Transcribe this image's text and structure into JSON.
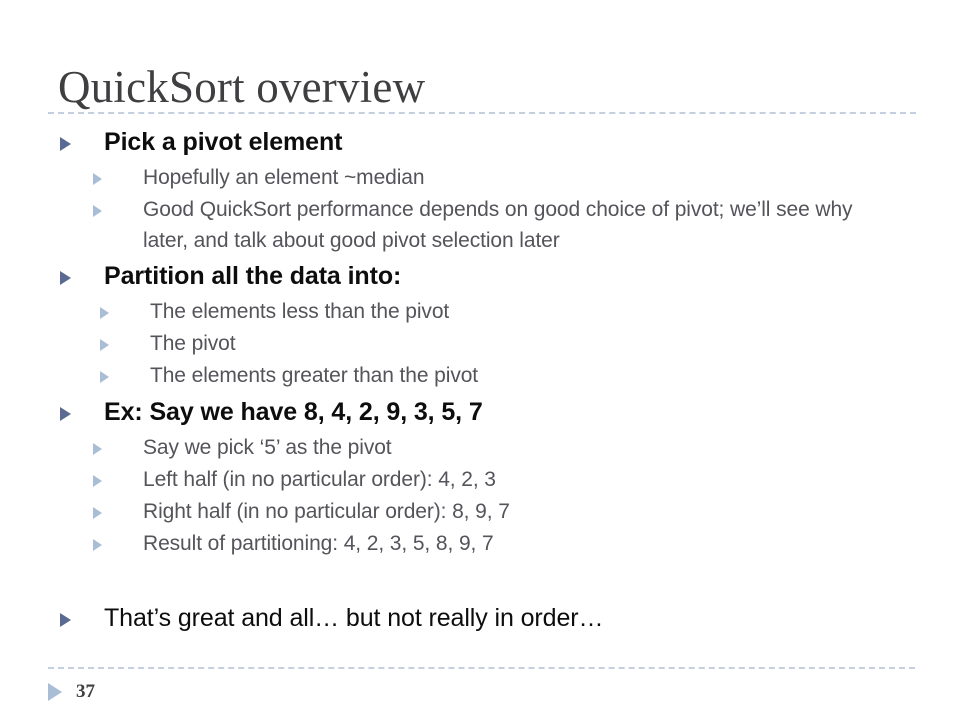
{
  "slide": {
    "title": "QuickSort overview",
    "page_number": "37",
    "accent_color_level1": "#5b6a93",
    "accent_color_level2": "#a9bdd4",
    "title_color": "#3f3f42",
    "rule_color": "#c4cfe0",
    "body_text_color": "#54545a",
    "heading_text_color": "#0d0d0d"
  },
  "bullets": [
    {
      "level": 1,
      "bold": true,
      "text": "Pick a pivot element"
    },
    {
      "level": 2,
      "indent": "a",
      "text": "Hopefully an element ~median"
    },
    {
      "level": 2,
      "indent": "a",
      "text": "Good QuickSort performance depends on good choice of pivot; we’ll see why later, and talk about good pivot selection later"
    },
    {
      "level": 1,
      "bold": true,
      "text": "Partition all the data into:"
    },
    {
      "level": 2,
      "indent": "b",
      "text": "The elements less than the pivot"
    },
    {
      "level": 2,
      "indent": "b",
      "text": "The pivot"
    },
    {
      "level": 2,
      "indent": "b",
      "text": "The elements greater than the pivot"
    },
    {
      "level": 1,
      "bold": true,
      "text": "Ex:  Say we have 8, 4, 2, 9, 3, 5, 7"
    },
    {
      "level": 2,
      "indent": "a",
      "text": "Say we pick ‘5’ as the pivot"
    },
    {
      "level": 2,
      "indent": "a",
      "text": "Left half (in no particular order): 4, 2, 3"
    },
    {
      "level": 2,
      "indent": "a",
      "text": "Right half (in no particular order): 8, 9, 7"
    },
    {
      "level": 2,
      "indent": "a",
      "text": "Result of partitioning: 4, 2, 3, 5, 8, 9, 7"
    },
    {
      "level": 1,
      "bold": false,
      "text": "That’s great and all… but not really in order…"
    }
  ]
}
